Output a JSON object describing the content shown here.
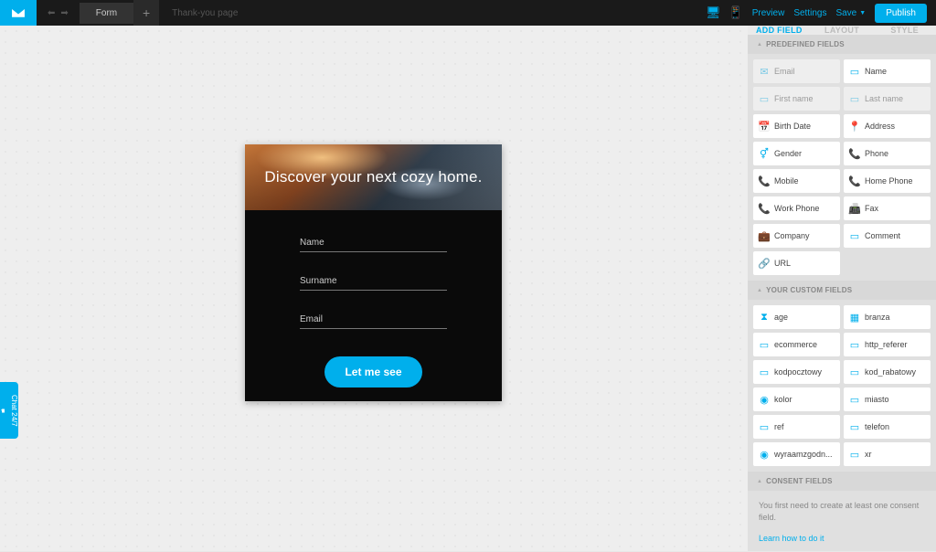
{
  "top": {
    "tabs": [
      "Form"
    ],
    "ghost_tab": "Thank-you page",
    "preview": "Preview",
    "settings": "Settings",
    "save": "Save",
    "publish": "Publish"
  },
  "sidebar_tabs": {
    "add_field": "ADD FIELD",
    "layout": "LAYOUT",
    "style": "STYLE"
  },
  "sections": {
    "predefined": "PREDEFINED FIELDS",
    "custom": "YOUR CUSTOM FIELDS",
    "consent": "CONSENT FIELDS"
  },
  "predefined_fields": [
    {
      "label": "Email",
      "icon": "mail",
      "disabled": true
    },
    {
      "label": "Name",
      "icon": "box",
      "disabled": false
    },
    {
      "label": "First name",
      "icon": "box",
      "disabled": true
    },
    {
      "label": "Last name",
      "icon": "box",
      "disabled": true
    },
    {
      "label": "Birth Date",
      "icon": "calendar",
      "disabled": false
    },
    {
      "label": "Address",
      "icon": "pin",
      "disabled": false
    },
    {
      "label": "Gender",
      "icon": "gender",
      "disabled": false
    },
    {
      "label": "Phone",
      "icon": "phone",
      "disabled": false
    },
    {
      "label": "Mobile",
      "icon": "phone",
      "disabled": false
    },
    {
      "label": "Home Phone",
      "icon": "phone",
      "disabled": false
    },
    {
      "label": "Work Phone",
      "icon": "phone",
      "disabled": false
    },
    {
      "label": "Fax",
      "icon": "fax",
      "disabled": false
    },
    {
      "label": "Company",
      "icon": "briefcase",
      "disabled": false
    },
    {
      "label": "Comment",
      "icon": "box",
      "disabled": false
    },
    {
      "label": "URL",
      "icon": "link",
      "disabled": false
    }
  ],
  "custom_fields": [
    {
      "label": "age",
      "icon": "hourglass"
    },
    {
      "label": "branza",
      "icon": "grid"
    },
    {
      "label": "ecommerce",
      "icon": "box"
    },
    {
      "label": "http_referer",
      "icon": "box"
    },
    {
      "label": "kodpocztowy",
      "icon": "box"
    },
    {
      "label": "kod_rabatowy",
      "icon": "box"
    },
    {
      "label": "kolor",
      "icon": "radio"
    },
    {
      "label": "miasto",
      "icon": "box"
    },
    {
      "label": "ref",
      "icon": "box"
    },
    {
      "label": "telefon",
      "icon": "box"
    },
    {
      "label": "wyraamzgodn...",
      "icon": "radio"
    },
    {
      "label": "xr",
      "icon": "box"
    }
  ],
  "consent": {
    "text": "You first need to create at least one consent field.",
    "link": "Learn how to do it"
  },
  "form": {
    "headline": "Discover your next cozy home.",
    "ph_name": "Name",
    "ph_surname": "Surname",
    "ph_email": "Email",
    "button": "Let me see"
  },
  "chat": {
    "label": "Chat 24/7"
  }
}
